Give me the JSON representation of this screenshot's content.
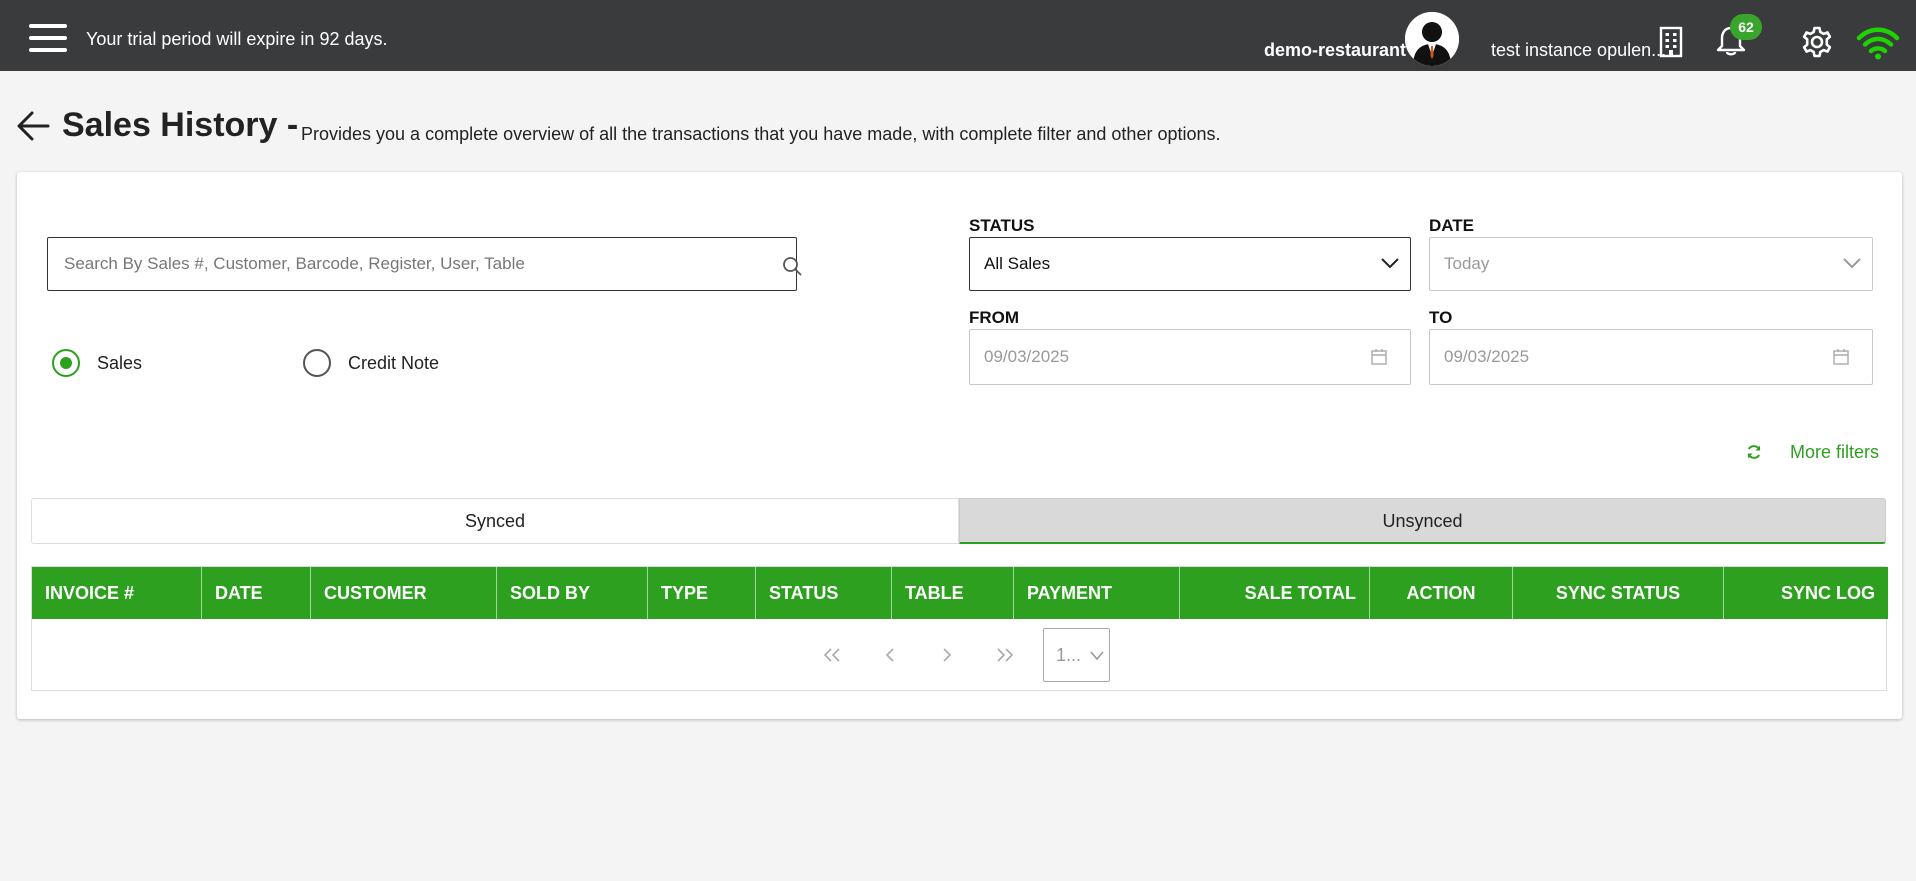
{
  "topbar": {
    "trial_message": "Your trial period will expire in 92 days.",
    "restaurant_name": "demo-restaurant",
    "instance_name": "test instance opulen...",
    "notification_count": "62",
    "wifi_color": "#1ed400"
  },
  "page": {
    "title": "Sales History -",
    "description": "Provides you a complete overview of all the transactions that you have made, with complete filter and other options."
  },
  "filters": {
    "search_placeholder": "Search By Sales #, Customer, Barcode, Register, User, Table",
    "radio_sales": "Sales",
    "radio_credit_note": "Credit Note",
    "radio_selected": "Sales",
    "status_label": "STATUS",
    "status_value": "All Sales",
    "date_label": "DATE",
    "date_value": "Today",
    "from_label": "FROM",
    "from_value": "09/03/2025",
    "to_label": "TO",
    "to_value": "09/03/2025",
    "more_filters": "More filters"
  },
  "tabs": {
    "synced": "Synced",
    "unsynced": "Unsynced",
    "active": "Unsynced"
  },
  "table": {
    "columns": [
      "INVOICE #",
      "DATE",
      "CUSTOMER",
      "SOLD BY",
      "TYPE",
      "STATUS",
      "TABLE",
      "PAYMENT",
      "SALE TOTAL",
      "ACTION",
      "SYNC STATUS",
      "SYNC LOG"
    ],
    "rows": []
  },
  "pagination": {
    "page_value": "1..."
  },
  "colors": {
    "accent": "#2da01f",
    "topbar": "#3a3b3c"
  }
}
